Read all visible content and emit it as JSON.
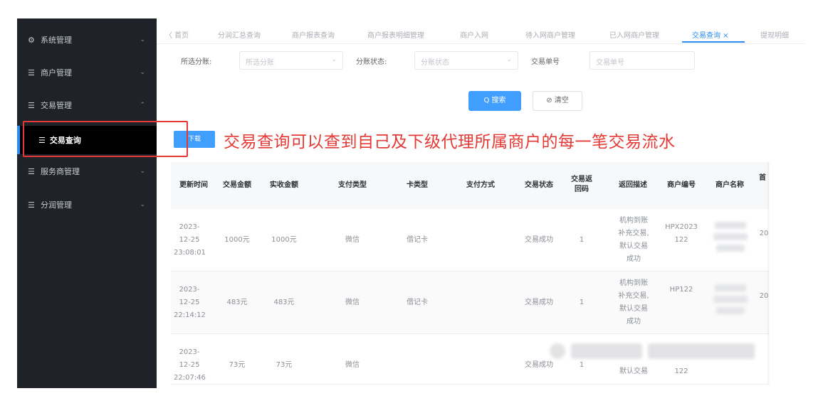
{
  "sidebar": {
    "items": [
      {
        "icon": "gear-icon",
        "label": "系统管理",
        "chevron": "⌄"
      },
      {
        "icon": "list-icon",
        "label": "商户管理",
        "chevron": "⌄"
      },
      {
        "icon": "list-icon",
        "label": "交易管理",
        "chevron": "⌃"
      },
      {
        "icon": "list-icon",
        "label": "服务商管理",
        "chevron": "⌄"
      },
      {
        "icon": "list-icon",
        "label": "分润管理",
        "chevron": "⌄"
      }
    ],
    "active_sub": {
      "icon": "list-icon",
      "label": "交易查询"
    }
  },
  "tabs": [
    {
      "label": "〈  首页"
    },
    {
      "label": "分润汇总查询"
    },
    {
      "label": "商户报表查询"
    },
    {
      "label": "商户报表明细管理"
    },
    {
      "label": "商户入网"
    },
    {
      "label": "待入网商户管理"
    },
    {
      "label": "已入网商户管理"
    },
    {
      "label": "交易查询  ×"
    },
    {
      "label": "提现明细"
    }
  ],
  "filters": {
    "agent_label": "所选分账:",
    "agent_placeholder": "所选分账",
    "status_label": "分账状态:",
    "status_placeholder": "分账状态",
    "txn_no_label": "交易单号",
    "txn_no_placeholder": "交易单号",
    "dropdown_glyph": "⌄"
  },
  "buttons": {
    "search": "Q 搜索",
    "clear": "⊘ 清空",
    "download": "下载"
  },
  "annotation": "交易查询可以查到自己及下级代理所属商户的每一笔交易流水",
  "table": {
    "headers": [
      "更新时间",
      "交易金额",
      "实收金额",
      "支付类型",
      "卡类型",
      "支付方式",
      "交易状态",
      "交易返回码",
      "返回描述",
      "商户编号",
      "商户名称",
      "首"
    ],
    "rows": [
      {
        "time": "2023-12-25 23:08:01",
        "amount": "1000元",
        "received": "1000元",
        "pay_type": "微信",
        "card_type": "借记卡",
        "status": "交易成功",
        "code": "1",
        "desc": "机构到账补充交易,默认交易成功",
        "merchant_no": "HPX2023122",
        "extra": "20"
      },
      {
        "time": "2023-12-25 22:14:12",
        "amount": "483元",
        "received": "483元",
        "pay_type": "微信",
        "card_type": "借记卡",
        "status": "交易成功",
        "code": "1",
        "desc": "机构到账补充交易,默认交易成功",
        "merchant_no": "HP122",
        "extra": "20"
      },
      {
        "time": "2023-12-25 22:07:46",
        "amount": "73元",
        "received": "73元",
        "pay_type": "微信",
        "card_type": "",
        "status": "交易成功",
        "code": "1",
        "desc": "默认交易",
        "merchant_no": "122",
        "extra": ""
      }
    ]
  },
  "colors": {
    "accent": "#409eff",
    "annotation": "#e53935",
    "sidebar_bg": "#1f2329"
  }
}
